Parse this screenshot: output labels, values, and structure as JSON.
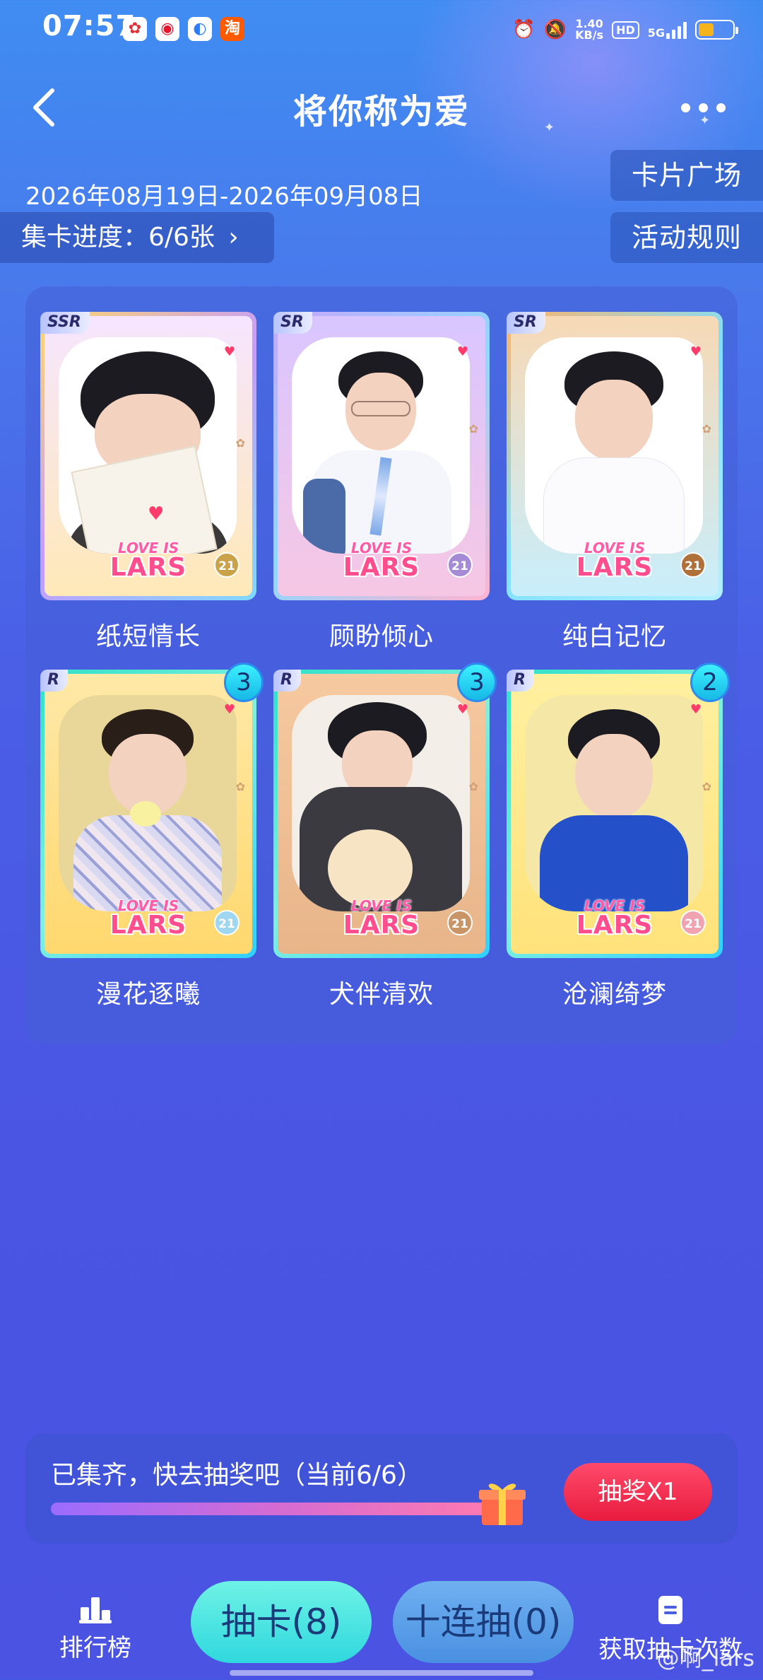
{
  "status_bar": {
    "time": "07:57",
    "net_speed_value": "1.40",
    "net_speed_unit": "KB/s",
    "hd": "HD",
    "signal": "5G",
    "battery_percent": 45
  },
  "header": {
    "title": "将你称为爱"
  },
  "event": {
    "date_range": "2026年08月19日-2026年09月08日",
    "progress_label": "集卡进度：6/6张",
    "card_square_label": "卡片广场",
    "rules_label": "活动规则"
  },
  "cards": [
    {
      "rarity": "SSR",
      "name": "纸短情长",
      "count": "",
      "logo_top": "LOVE IS",
      "logo_bottom": "LARS",
      "badge": "21"
    },
    {
      "rarity": "SR",
      "name": "顾盼倾心",
      "count": "",
      "logo_top": "LOVE IS",
      "logo_bottom": "LARS",
      "badge": "21"
    },
    {
      "rarity": "SR",
      "name": "纯白记忆",
      "count": "",
      "logo_top": "LOVE IS",
      "logo_bottom": "LARS",
      "badge": "21"
    },
    {
      "rarity": "R",
      "name": "漫花逐曦",
      "count": "3",
      "logo_top": "LOVE IS",
      "logo_bottom": "LARS",
      "badge": "21"
    },
    {
      "rarity": "R",
      "name": "犬伴清欢",
      "count": "3",
      "logo_top": "LOVE IS",
      "logo_bottom": "LARS",
      "badge": "21"
    },
    {
      "rarity": "R",
      "name": "沧澜绮梦",
      "count": "2",
      "logo_top": "LOVE IS",
      "logo_bottom": "LARS",
      "badge": "21"
    }
  ],
  "lottery": {
    "status_text": "已集齐，快去抽奖吧（当前6/6）",
    "progress_fraction": 1.0,
    "draw_button": "抽奖X1"
  },
  "bottom_nav": {
    "ranking_label": "排行榜",
    "draw_card_label": "抽卡(8)",
    "ten_draw_label": "十连抽(0)",
    "get_chances_label": "获取抽卡次数"
  },
  "watermark": "@啊_lars",
  "colors": {
    "accent_red": "#e81c3e",
    "pill_cyan": "#3de6e6",
    "badge_cyan": "#3df0ff"
  }
}
